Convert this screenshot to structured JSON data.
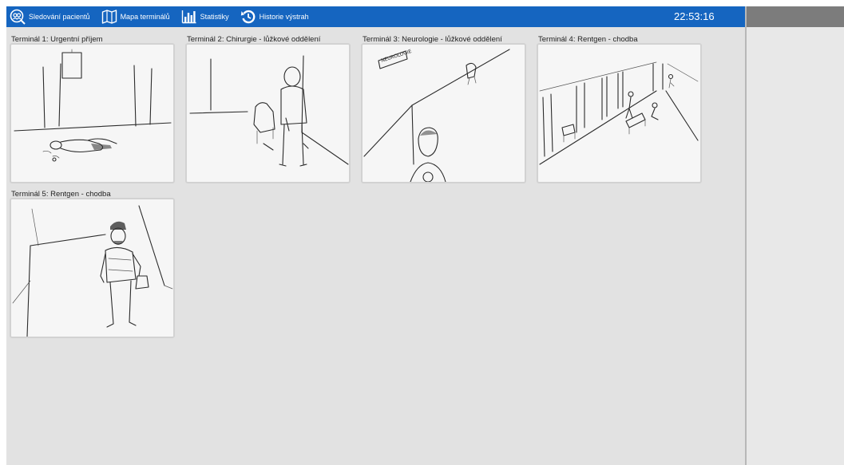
{
  "nav": {
    "items": [
      {
        "label": "Sledování pacientů",
        "icon": "patient-tracking-icon"
      },
      {
        "label": "Mapa terminálů",
        "icon": "map-icon"
      },
      {
        "label": "Statistiky",
        "icon": "bar-chart-icon"
      },
      {
        "label": "Historie výstrah",
        "icon": "history-icon"
      }
    ],
    "clock": "22:53:16"
  },
  "terminals": [
    {
      "label": "Terminál 1: Urgentní příjem",
      "scene": "person lying on the floor of a room"
    },
    {
      "label": "Terminál 2: Chirurgie - lůžkové oddělení",
      "scene": "hooded person standing next to a bench with bottles on the floor"
    },
    {
      "label": "Terminál 3: Neurologie - lůžkové oddělení",
      "scene": "corridor with a sign and a person's head in the foreground",
      "sign_text": "NEUROLOGIE"
    },
    {
      "label": "Terminál 4: Rentgen - chodba",
      "scene": "long corridor with doors, chairs and several people"
    },
    {
      "label": "Terminál 5: Rentgen - chodba",
      "scene": "man in a cap walking down a corridor carrying a bag"
    }
  ],
  "colors": {
    "topbar": "#1565c0",
    "background": "#e2e2e2",
    "side_rail_header": "#7c7c7c"
  }
}
